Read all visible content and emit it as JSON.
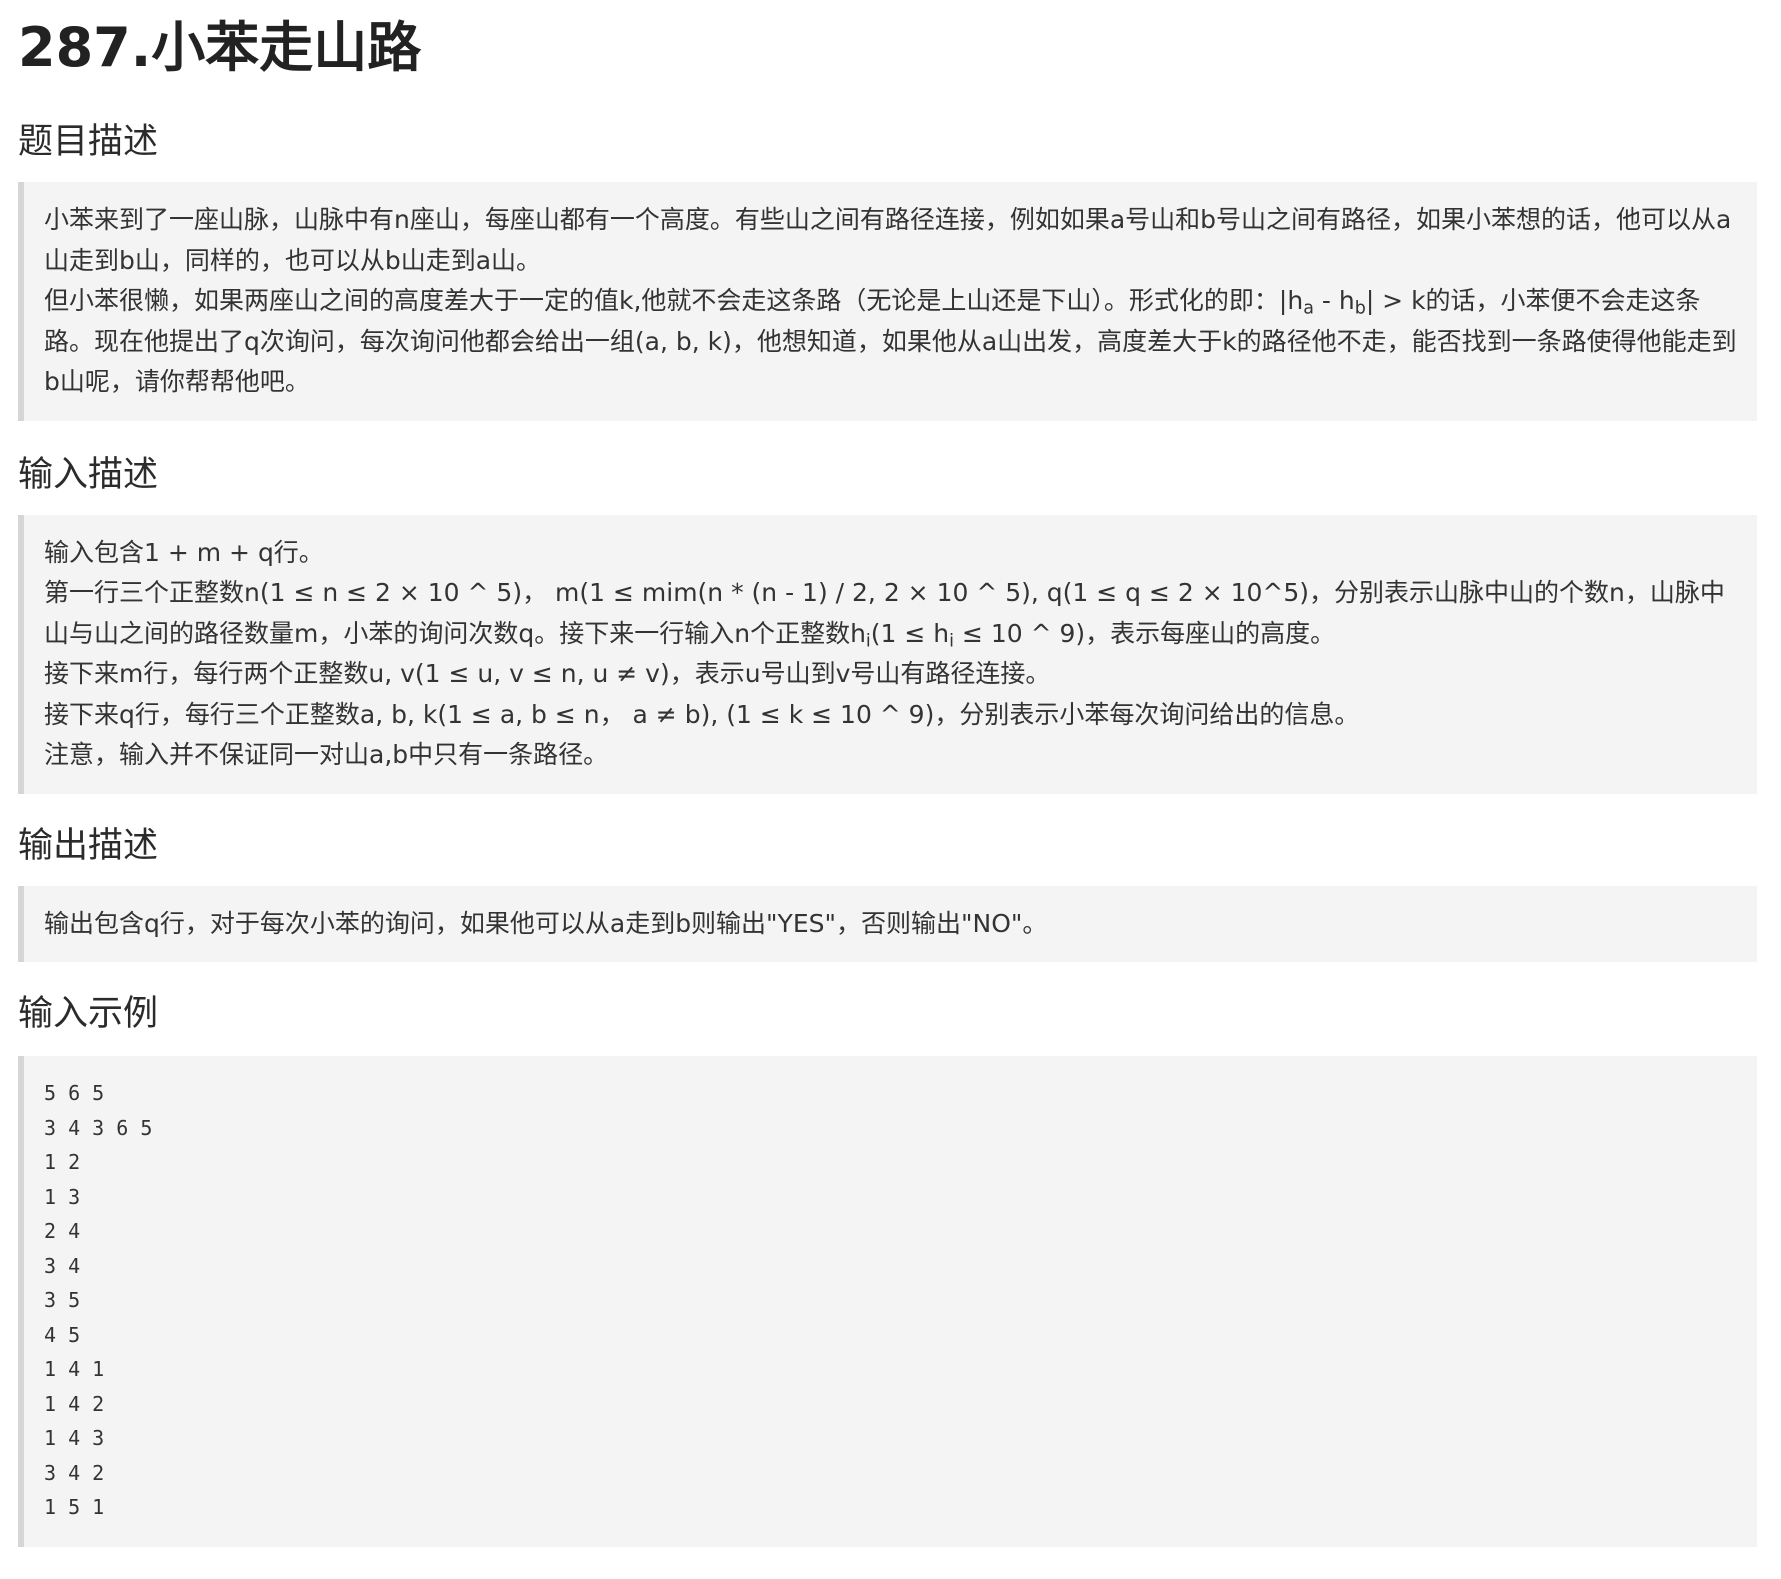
{
  "title": "287.小苯走山路",
  "sections": {
    "description": {
      "heading": "题目描述",
      "p1": "小苯来到了一座山脉，山脉中有n座山，每座山都有一个高度。有些山之间有路径连接，例如如果a号山和b号山之间有路径，如果小苯想的话，他可以从a山走到b山，同样的，也可以从b山走到a山。",
      "p2_before": "但小苯很懒，如果两座山之间的高度差大于一定的值k,他就不会走这条路（无论是上山还是下山）。形式化的即：|h",
      "p2_sub_a": "a",
      "p2_mid": " - h",
      "p2_sub_b": "b",
      "p2_after": "| > k的话，小苯便不会走这条路。现在他提出了q次询问，每次询问他都会给出一组(a, b, k)，他想知道，如果他从a山出发，高度差大于k的路径他不走，能否找到一条路使得他能走到b山呢，请你帮帮他吧。"
    },
    "input": {
      "heading": "输入描述",
      "line1": "输入包含1 + m + q行。",
      "line2_before": "第一行三个正整数n(1 ≤ n ≤ 2 × 10 ^ 5)， m(1 ≤ mim(n * (n - 1) / 2, 2 × 10 ^ 5), q(1 ≤ q ≤ 2 × 10^5)，分别表示山脉中山的个数n，山脉中山与山之间的路径数量m，小苯的询问次数q。接下来一行输入n个正整数h",
      "line2_sub1": "i",
      "line2_mid": "(1 ≤ h",
      "line2_sub2": "i",
      "line2_after": " ≤ 10 ^ 9)，表示每座山的高度。",
      "line3": "接下来m行，每行两个正整数u, v(1 ≤ u, v ≤ n, u ≠ v)，表示u号山到v号山有路径连接。",
      "line4": "接下来q行，每行三个正整数a, b, k(1 ≤ a, b ≤ n， a ≠ b), (1 ≤ k ≤ 10 ^ 9)，分别表示小苯每次询问给出的信息。",
      "line5": "注意，输入并不保证同一对山a,b中只有一条路径。"
    },
    "output": {
      "heading": "输出描述",
      "text": "输出包含q行，对于每次小苯的询问，如果他可以从a走到b则输出\"YES\"，否则输出\"NO\"。"
    },
    "example": {
      "heading": "输入示例",
      "lines": [
        "5 6 5",
        "3 4 3 6 5",
        "1 2",
        "1 3",
        "2 4",
        "3 4",
        "3 5",
        "4 5",
        "1 4 1",
        "1 4 2",
        "1 4 3",
        "3 4 2",
        "1 5 1"
      ]
    }
  }
}
